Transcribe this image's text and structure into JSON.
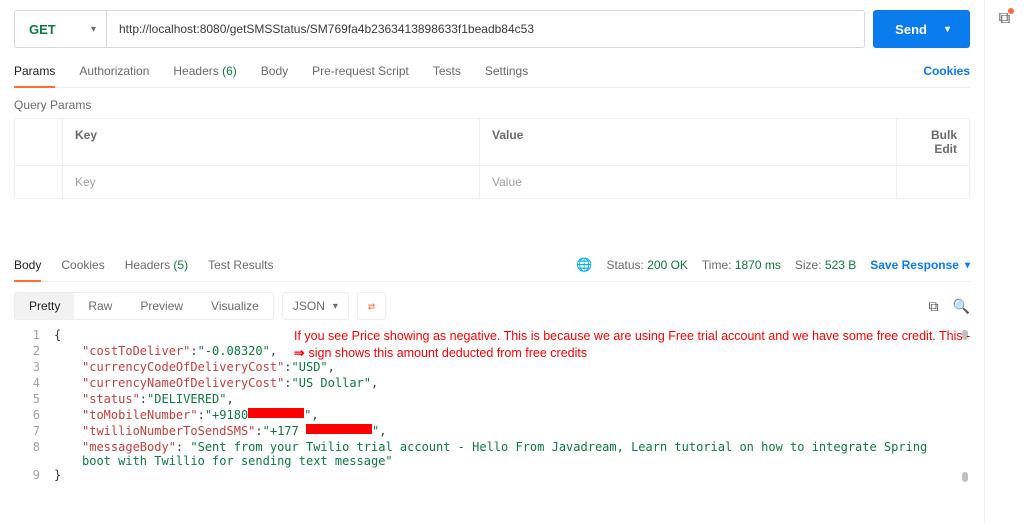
{
  "request": {
    "method": "GET",
    "url": "http://localhost:8080/getSMSStatus/SM769fa4b2363413898633f1beadb84c53",
    "send_label": "Send"
  },
  "tabs": {
    "items": [
      {
        "label": "Params"
      },
      {
        "label": "Authorization"
      },
      {
        "label": "Headers",
        "count": "(6)"
      },
      {
        "label": "Body"
      },
      {
        "label": "Pre-request Script"
      },
      {
        "label": "Tests"
      },
      {
        "label": "Settings"
      }
    ],
    "cookies_link": "Cookies"
  },
  "query": {
    "section_label": "Query Params",
    "headers": {
      "key": "Key",
      "value": "Value",
      "bulk": "Bulk Edit"
    },
    "placeholder": {
      "key": "Key",
      "value": "Value"
    }
  },
  "resp_tabs": {
    "items": [
      {
        "label": "Body"
      },
      {
        "label": "Cookies"
      },
      {
        "label": "Headers",
        "count": "(5)"
      },
      {
        "label": "Test Results"
      }
    ]
  },
  "resp_meta": {
    "status_label": "Status:",
    "status_value": "200 OK",
    "time_label": "Time:",
    "time_value": "1870 ms",
    "size_label": "Size:",
    "size_value": "523 B",
    "save_label": "Save Response"
  },
  "view": {
    "pretty": "Pretty",
    "raw": "Raw",
    "preview": "Preview",
    "visualize": "Visualize",
    "json_label": "JSON"
  },
  "json_body": {
    "l1_open": "{",
    "l2_key": "\"costToDeliver\"",
    "l2_val": "\"-0.08320\"",
    "l3_key": "\"currencyCodeOfDeliveryCost\"",
    "l3_val": "\"USD\"",
    "l4_key": "\"currencyNameOfDeliveryCost\"",
    "l4_val": "\"US Dollar\"",
    "l5_key": "\"status\"",
    "l5_val": "\"DELIVERED\"",
    "l6_key": "\"toMobileNumber\"",
    "l6_val_prefix": "\"+9180",
    "l6_val_suffix": "\"",
    "l7_key": "\"twillioNumberToSendSMS\"",
    "l7_val_prefix": "\"+177",
    "l7_val_suffix": "\"",
    "l8_key": "\"messageBody\"",
    "l8_val": "\"Sent from your Twilio trial account - Hello From Javadream, Learn tutorial on how to integrate Spring boot with Twillio for sending text message\"",
    "l9_close": "}"
  },
  "annotation": {
    "line1": "If you see Price showing as negative. This is because we are using Free trial account and we have some free credit. This -",
    "line2": "sign shows this amount deducted from free credits"
  }
}
